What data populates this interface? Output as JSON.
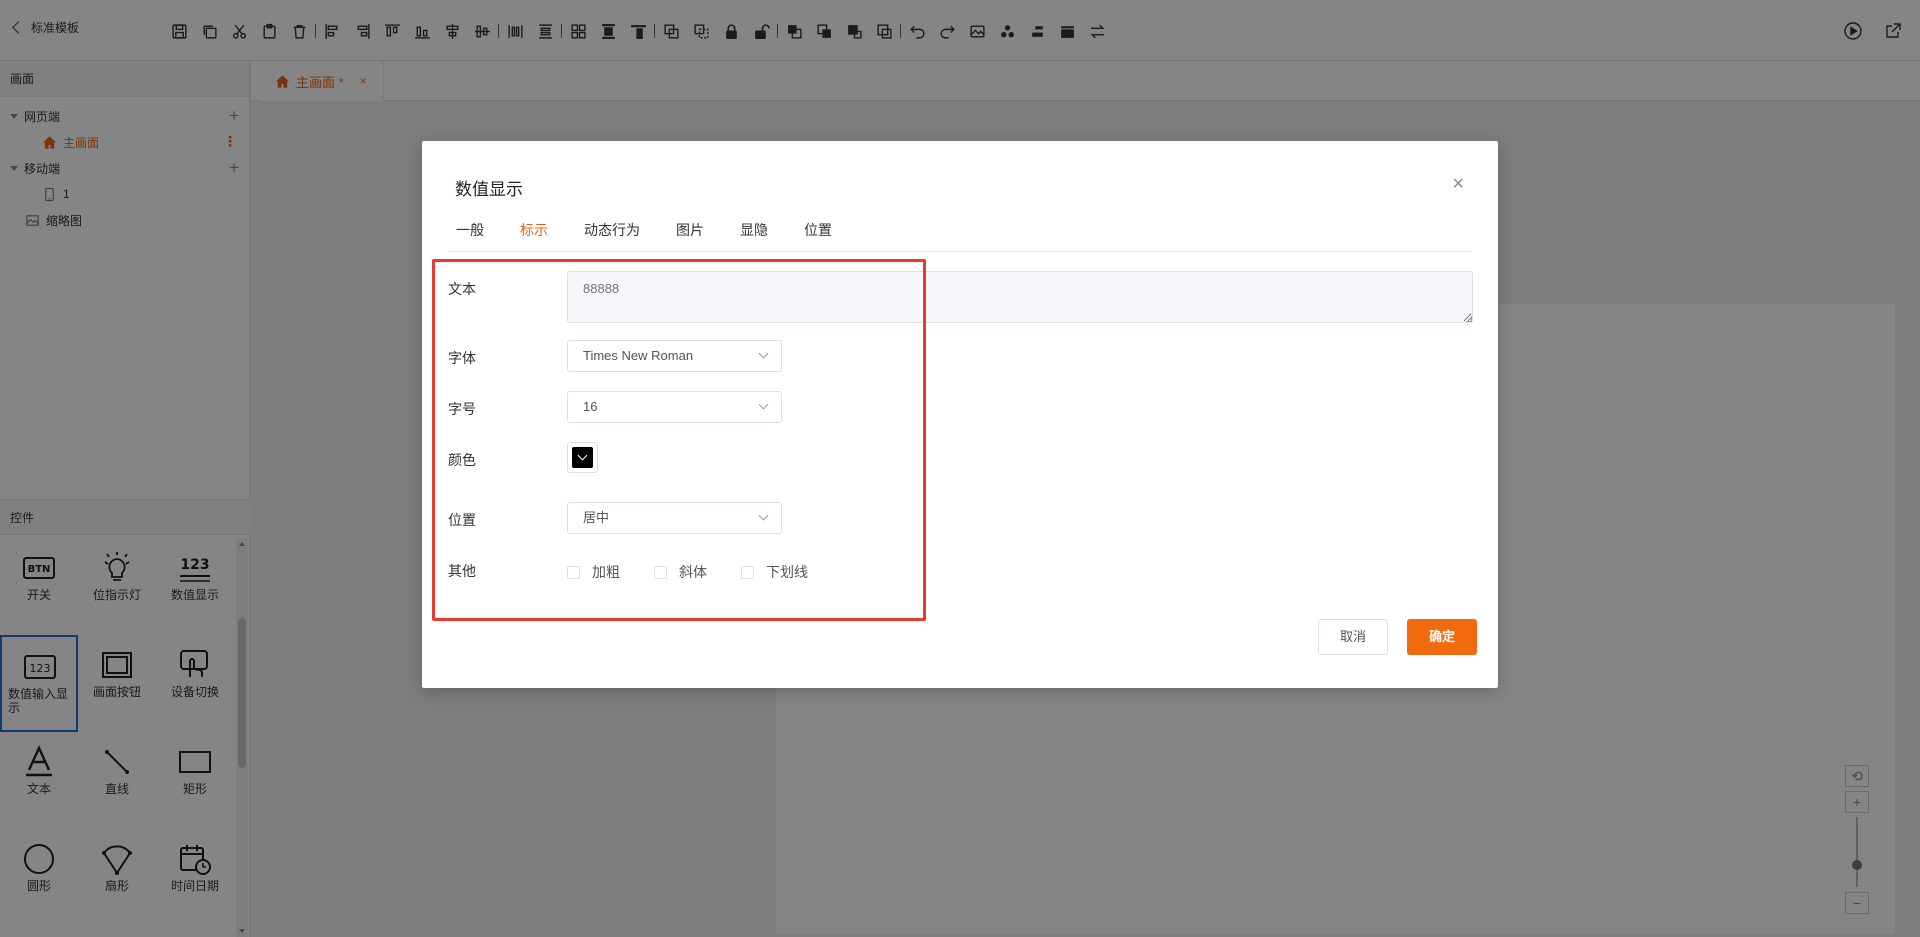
{
  "topbar": {
    "back_label": "标准模板"
  },
  "left_panel": {
    "screens_title": "画面",
    "web_group": "网页端",
    "main_screen": "主画面",
    "mobile_group": "移动端",
    "mobile_item": "1",
    "thumbnail": "缩略图",
    "controls_title": "控件",
    "controls": [
      {
        "label": "开关",
        "icon": "btn-icon"
      },
      {
        "label": "位指示灯",
        "icon": "bulb-icon"
      },
      {
        "label": "数值显示",
        "icon": "numeric-display-icon"
      },
      {
        "label": "数值输入显示",
        "icon": "numeric-input-icon"
      },
      {
        "label": "画面按钮",
        "icon": "screen-button-icon"
      },
      {
        "label": "设备切换",
        "icon": "device-switch-icon"
      },
      {
        "label": "文本",
        "icon": "text-icon"
      },
      {
        "label": "直线",
        "icon": "line-icon"
      },
      {
        "label": "矩形",
        "icon": "rectangle-icon"
      },
      {
        "label": "圆形",
        "icon": "circle-icon"
      },
      {
        "label": "扇形",
        "icon": "sector-icon"
      },
      {
        "label": "时间日期",
        "icon": "datetime-icon"
      }
    ]
  },
  "doc_tab": {
    "label": "主画面 *",
    "close": "×"
  },
  "modal": {
    "title": "数值显示",
    "close": "×",
    "tabs": [
      "一般",
      "标示",
      "动态行为",
      "图片",
      "显隐",
      "位置"
    ],
    "active_tab": "标示",
    "fields": {
      "text_label": "文本",
      "text_placeholder": "88888",
      "font_label": "字体",
      "font_value": "Times New Roman",
      "size_label": "字号",
      "size_value": "16",
      "color_label": "颜色",
      "color_value": "#000000",
      "position_label": "位置",
      "position_value": "居中",
      "other_label": "其他",
      "bold": "加粗",
      "italic": "斜体",
      "underline": "下划线"
    },
    "cancel": "取消",
    "ok": "确定"
  },
  "colors": {
    "accent": "#e8641c",
    "primary_button": "#f26a0e",
    "highlight_frame": "#e83a2f"
  }
}
